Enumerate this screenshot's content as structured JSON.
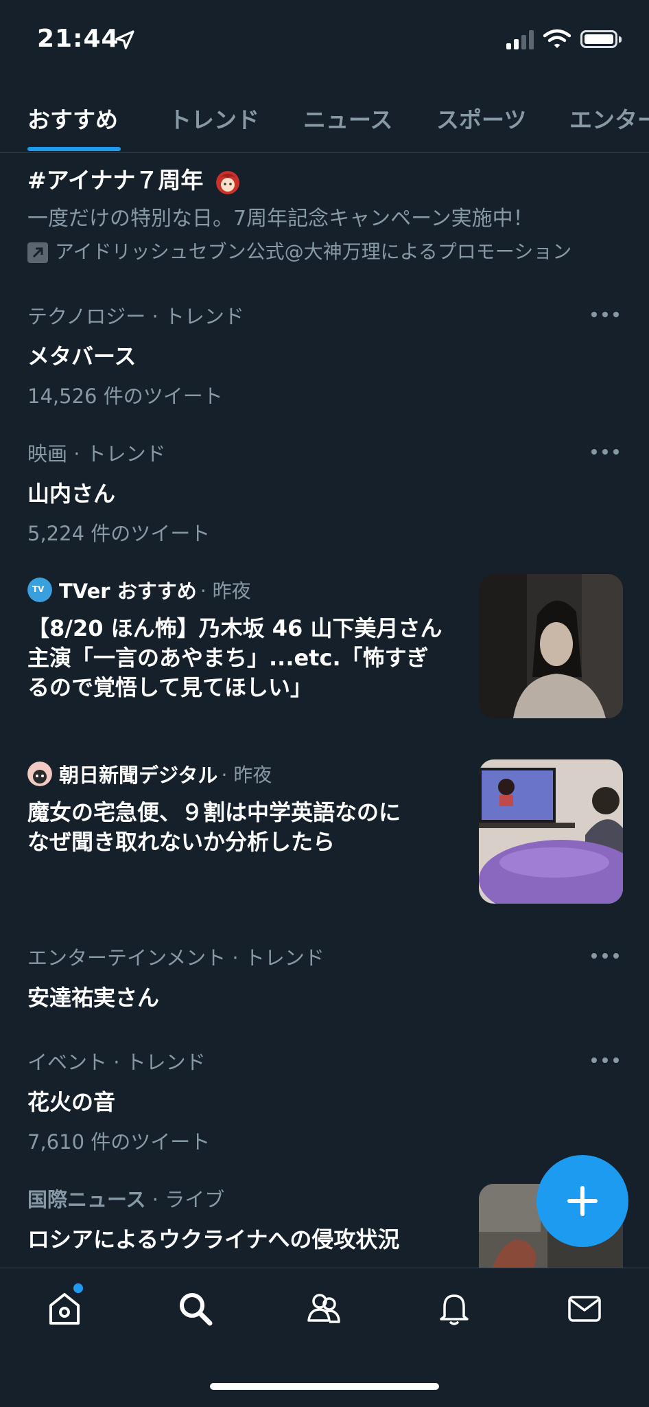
{
  "status": {
    "time": "21:44"
  },
  "tabs": [
    "おすすめ",
    "トレンド",
    "ニュース",
    "スポーツ",
    "エンター"
  ],
  "promo": {
    "title": "#アイナナ７周年",
    "desc": "一度だけの特別な日。7周年記念キャンペーン実施中！",
    "by": "アイドリッシュセブン公式@大神万理によるプロモーション"
  },
  "trends": [
    {
      "category": "テクノロジー · トレンド",
      "title": "メタバース",
      "count": "14,526 件のツイート"
    },
    {
      "category": "映画 · トレンド",
      "title": "山内さん",
      "count": "5,224 件のツイート"
    },
    {
      "category": "エンターテインメント · トレンド",
      "title": "安達祐実さん",
      "count": ""
    },
    {
      "category": "イベント · トレンド",
      "title": "花火の音",
      "count": "7,610 件のツイート"
    }
  ],
  "news": [
    {
      "source": "TVer おすすめ",
      "ago": "· 昨夜",
      "line1": "【8/20 ほん怖】乃木坂 46 山下美月さん",
      "line2": "主演「一言のあやまち」...etc.「怖すぎ",
      "line3": "るので覚悟して見てほしい」"
    },
    {
      "source": "朝日新聞デジタル",
      "ago": "· 昨夜",
      "line1": "魔女の宅急便、９割は中学英語なのに",
      "line2": "なぜ聞き取れないか分析したら",
      "line3": ""
    }
  ],
  "live": {
    "category": "国際ニュース",
    "tag": "· ライブ",
    "title": "ロシアによるウクライナへの侵攻状況"
  },
  "colors": {
    "background": "#15202b",
    "accent": "#1d9bf0",
    "secondary_text": "#8899a6"
  },
  "nav": [
    "home-icon",
    "search-icon",
    "communities-icon",
    "notifications-icon",
    "messages-icon"
  ]
}
